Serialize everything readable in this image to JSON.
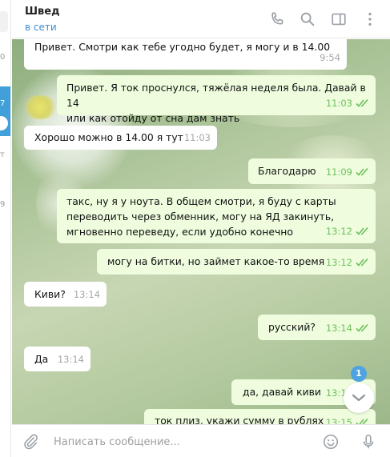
{
  "sidebar": {
    "counts": [
      "0",
      "7",
      "т",
      "9"
    ]
  },
  "header": {
    "title": "Швед",
    "status": "в сети",
    "icons": [
      "phone-icon",
      "search-icon",
      "sidebar-toggle-icon",
      "more-vertical-icon"
    ]
  },
  "messages": [
    {
      "dir": "in",
      "text": "Привет. Смотри как тебе угодно будет, я могу и в 14.00",
      "time": "9:54",
      "read": false
    },
    {
      "dir": "out",
      "text": "Привет. Я ток проснулся, тяжёлая неделя была. Давай в 14\nили как отойду от сна дам знать",
      "time": "11:03",
      "read": true
    },
    {
      "dir": "in",
      "text": "Хорошо можно в 14.00 я тут",
      "time": "11:03",
      "read": false
    },
    {
      "dir": "out",
      "text": "Благодарю",
      "time": "11:09",
      "read": true
    },
    {
      "dir": "out",
      "text": "такс, ну я у ноута. В общем смотри, я буду с карты\nпереводить через обменник, могу на ЯД закинуть,\nмгновенно переведу, если удобно конечно",
      "time": "13:12",
      "read": true
    },
    {
      "dir": "out",
      "text": "могу на битки, но займет какое-то время",
      "time": "13:12",
      "read": true
    },
    {
      "dir": "in",
      "text": "Киви?",
      "time": "13:14",
      "read": false
    },
    {
      "dir": "out",
      "text": "русский?",
      "time": "13:14",
      "read": true
    },
    {
      "dir": "in",
      "text": "Да",
      "time": "13:14",
      "read": false
    },
    {
      "dir": "out",
      "text": "да, давай киви",
      "time": "13:15",
      "read": true
    },
    {
      "dir": "out",
      "text": "ток плиз, укажи сумму в рублях",
      "time": "13:15",
      "read": true
    }
  ],
  "scroll_down": {
    "unread_count": "1"
  },
  "composer": {
    "placeholder": "Написать сообщение...",
    "icons": [
      "attach-icon",
      "emoji-icon",
      "microphone-icon"
    ]
  },
  "colors": {
    "accent": "#3a8cd3",
    "outgoing_bubble": "#effdde",
    "incoming_bubble": "#ffffff",
    "read_check": "#6cbf5c",
    "badge": "#4fa3e0"
  }
}
